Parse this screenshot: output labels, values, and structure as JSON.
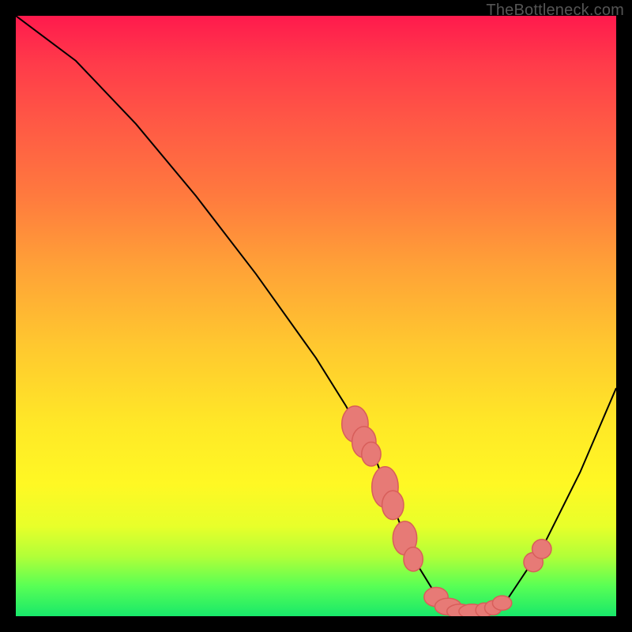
{
  "watermark": "TheBottleneck.com",
  "chart_data": {
    "type": "line",
    "title": "",
    "xlabel": "",
    "ylabel": "",
    "xlim": [
      0,
      100
    ],
    "ylim": [
      0,
      100
    ],
    "grid": false,
    "series": [
      {
        "name": "curve",
        "x": [
          0,
          4,
          10,
          20,
          30,
          40,
          50,
          55,
          60,
          63,
          66,
          70,
          74,
          78,
          82,
          88,
          94,
          100
        ],
        "y": [
          100,
          97,
          92.5,
          82,
          70,
          57,
          43,
          35,
          26,
          18,
          10,
          3.5,
          0.5,
          0.5,
          3,
          12,
          24,
          38
        ]
      }
    ],
    "markers": [
      {
        "name": "cluster-a",
        "x": 56.5,
        "y": 32,
        "rx": 2.2,
        "ry": 3.0
      },
      {
        "name": "cluster-a",
        "x": 58.0,
        "y": 29,
        "rx": 2.0,
        "ry": 2.6
      },
      {
        "name": "cluster-a",
        "x": 59.2,
        "y": 27,
        "rx": 1.6,
        "ry": 2.0
      },
      {
        "name": "cluster-b",
        "x": 61.5,
        "y": 21.5,
        "rx": 2.2,
        "ry": 3.4
      },
      {
        "name": "cluster-b",
        "x": 62.8,
        "y": 18.5,
        "rx": 1.8,
        "ry": 2.4
      },
      {
        "name": "cluster-c",
        "x": 64.8,
        "y": 13.0,
        "rx": 2.0,
        "ry": 2.8
      },
      {
        "name": "cluster-c",
        "x": 66.2,
        "y": 9.5,
        "rx": 1.6,
        "ry": 2.0
      },
      {
        "name": "cluster-d",
        "x": 70.0,
        "y": 3.2,
        "rx": 2.0,
        "ry": 1.6
      },
      {
        "name": "cluster-d",
        "x": 72.0,
        "y": 1.6,
        "rx": 2.2,
        "ry": 1.4
      },
      {
        "name": "cluster-d",
        "x": 74.0,
        "y": 0.8,
        "rx": 2.2,
        "ry": 1.2
      },
      {
        "name": "cluster-d",
        "x": 76.0,
        "y": 0.8,
        "rx": 2.2,
        "ry": 1.2
      },
      {
        "name": "cluster-d",
        "x": 78.0,
        "y": 1.0,
        "rx": 1.4,
        "ry": 1.2
      },
      {
        "name": "cluster-d",
        "x": 79.5,
        "y": 1.4,
        "rx": 1.4,
        "ry": 1.2
      },
      {
        "name": "cluster-d",
        "x": 81.0,
        "y": 2.2,
        "rx": 1.6,
        "ry": 1.2
      },
      {
        "name": "cluster-e",
        "x": 86.2,
        "y": 9.0,
        "rx": 1.6,
        "ry": 1.6
      },
      {
        "name": "cluster-e",
        "x": 87.6,
        "y": 11.2,
        "rx": 1.6,
        "ry": 1.6
      }
    ],
    "colors": {
      "curve": "#000000",
      "marker_fill": "#e77a76",
      "marker_stroke": "#d85e5a"
    }
  }
}
